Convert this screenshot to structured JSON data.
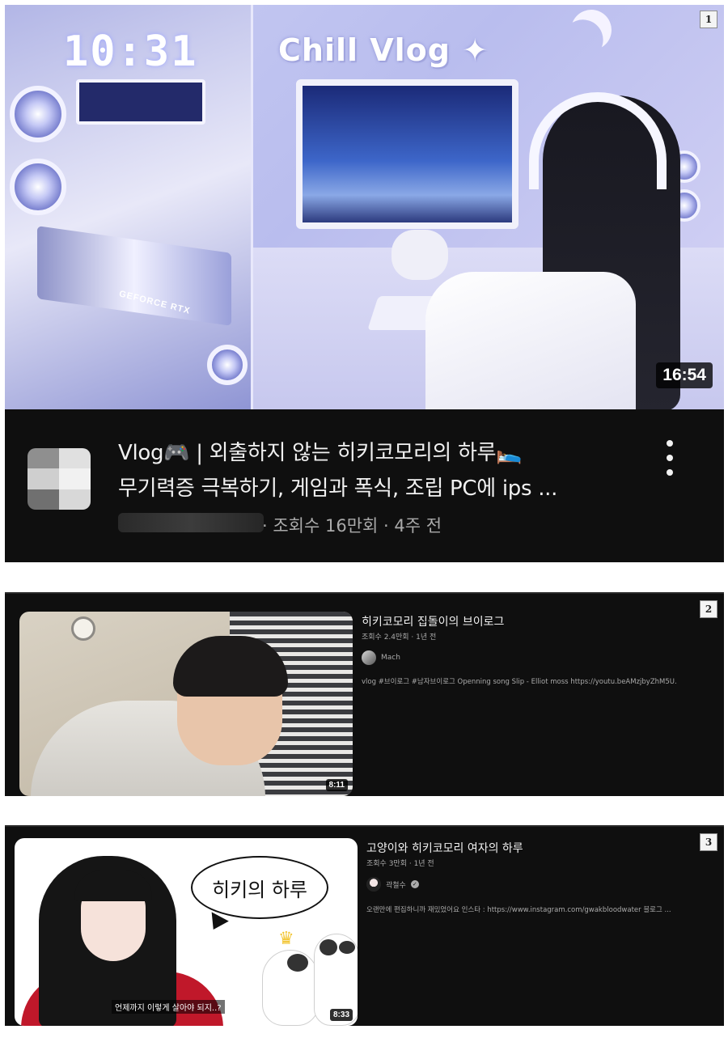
{
  "panel1": {
    "badge": "1",
    "thumbnail_overlay": {
      "clock": "10:31",
      "title": "Chill Vlog",
      "gpu_label": "GEFORCE RTX"
    },
    "duration": "16:54",
    "title_line1": "Vlog🎮 | 외출하지 않는 히키코모리의 하루🛌",
    "title_line2": "무기력증 극복하기, 게임과 폭식, 조립 PC에 ips ...",
    "meta": "· 조회수 16만회 · 4주 전",
    "menu_icon": "kebab-menu-icon"
  },
  "panel2": {
    "badge": "2",
    "title": "히키코모리 집돌이의 브이로그",
    "meta": "조회수 2.4만회 · 1년 전",
    "channel": "Mach",
    "description": "vlog #브이로그 #남자브이로그 Openning song Slip - Elliot moss https://youtu.beAMzjbyZhM5U.",
    "duration": "8:11"
  },
  "panel3": {
    "badge": "3",
    "title": "고양이와 히키코모리 여자의 하루",
    "meta": "조회수 3만회 · 1년 전",
    "channel": "곽철수",
    "verified_icon": "verified-check-icon",
    "description": "오랜만에 편집하니까 재밌었어요 인스타 : https://www.instagram.com/gwakbloodwater 블로그 ...",
    "bubble_text": "히키의 하루",
    "subtitle": "언제까지 이렇게 살아야 되지..?",
    "duration": "8:33"
  },
  "colors": {
    "background": "#0f0f0f",
    "text_primary": "#f1f1f1",
    "text_secondary": "#aaaaaa"
  }
}
